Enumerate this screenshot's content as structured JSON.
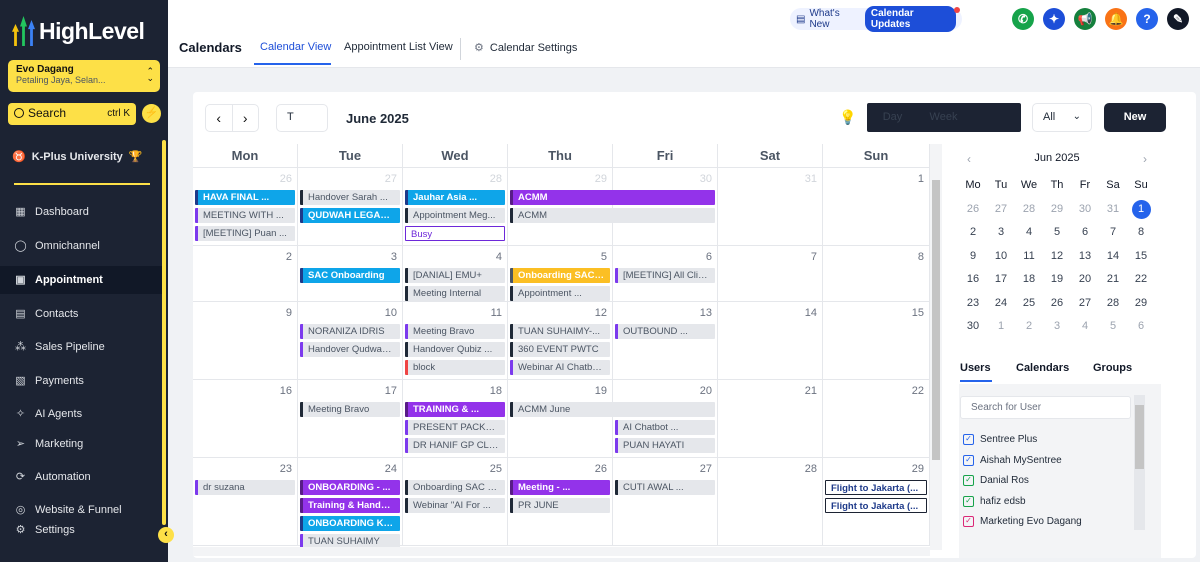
{
  "sidebar": {
    "brand": "HighLevel",
    "account": {
      "name": "Evo Dagang",
      "location": "Petaling Jaya, Selan..."
    },
    "search": {
      "label": "Search",
      "shortcut": "ctrl K"
    },
    "university": "K-Plus University",
    "items": [
      {
        "label": "Dashboard",
        "icon": "dashboard-icon"
      },
      {
        "label": "Omnichannel",
        "icon": "chat-icon"
      },
      {
        "label": "Appointment",
        "icon": "calendar-icon"
      },
      {
        "label": "Contacts",
        "icon": "contacts-icon"
      },
      {
        "label": "Sales Pipeline",
        "icon": "pipeline-icon"
      },
      {
        "label": "Payments",
        "icon": "payments-icon"
      },
      {
        "label": "AI Agents",
        "icon": "sparkle-icon"
      },
      {
        "label": "Marketing",
        "icon": "send-icon"
      },
      {
        "label": "Automation",
        "icon": "automation-icon"
      },
      {
        "label": "Website & Funnel",
        "icon": "globe-icon"
      },
      {
        "label": "Settings",
        "icon": "gear-icon"
      }
    ]
  },
  "header": {
    "title": "Calendars",
    "tabs": [
      {
        "label": "Calendar View"
      },
      {
        "label": "Appointment List View"
      },
      {
        "label": "Calendar Settings"
      }
    ],
    "whats_new": "What's New",
    "updates": "Calendar Updates"
  },
  "toolbar": {
    "today_label": "T",
    "month": "June 2025",
    "views": [
      "Day",
      "Week",
      ""
    ],
    "filter": "All",
    "new_label": "New"
  },
  "colors": {
    "accent": "#2563eb",
    "sidebar": "#1c2333",
    "highlight": "#fde047"
  },
  "calendar": {
    "weekdays": [
      "Mon",
      "Tue",
      "Wed",
      "Thu",
      "Fri",
      "Sat",
      "Sun"
    ],
    "weeks": [
      [
        {
          "d": "26",
          "o": true
        },
        {
          "d": "27",
          "o": true
        },
        {
          "d": "28",
          "o": true
        },
        {
          "d": "29",
          "o": true
        },
        {
          "d": "30",
          "o": true
        },
        {
          "d": "31",
          "o": true
        },
        {
          "d": "1"
        }
      ],
      [
        {
          "d": "2"
        },
        {
          "d": "3"
        },
        {
          "d": "4"
        },
        {
          "d": "5"
        },
        {
          "d": "6"
        },
        {
          "d": "7"
        },
        {
          "d": "8"
        }
      ],
      [
        {
          "d": "9"
        },
        {
          "d": "10"
        },
        {
          "d": "11"
        },
        {
          "d": "12"
        },
        {
          "d": "13"
        },
        {
          "d": "14"
        },
        {
          "d": "15"
        }
      ],
      [
        {
          "d": "16"
        },
        {
          "d": "17"
        },
        {
          "d": "18"
        },
        {
          "d": "19"
        },
        {
          "d": "20"
        },
        {
          "d": "21"
        },
        {
          "d": "22"
        }
      ],
      [
        {
          "d": "23"
        },
        {
          "d": "24"
        },
        {
          "d": "25"
        },
        {
          "d": "26"
        },
        {
          "d": "27"
        },
        {
          "d": "28"
        },
        {
          "d": "29"
        }
      ]
    ],
    "events": [
      {
        "w": 0,
        "d": 0,
        "s": 0,
        "span": 1,
        "t": "HAVA FINAL ...",
        "k": "blue"
      },
      {
        "w": 0,
        "d": 0,
        "s": 1,
        "span": 1,
        "t": "MEETING WITH ...",
        "k": "gray"
      },
      {
        "w": 0,
        "d": 0,
        "s": 2,
        "span": 1,
        "t": "[MEETING] Puan ...",
        "k": "gray"
      },
      {
        "w": 0,
        "d": 1,
        "s": 0,
        "span": 1,
        "t": "Handover Sarah ...",
        "k": "gray dk"
      },
      {
        "w": 0,
        "d": 1,
        "s": 1,
        "span": 1,
        "t": "QUDWAH LEGACY...",
        "k": "blue"
      },
      {
        "w": 0,
        "d": 2,
        "s": 0,
        "span": 1,
        "t": "Jauhar Asia ...",
        "k": "blue"
      },
      {
        "w": 0,
        "d": 2,
        "s": 1,
        "span": 1,
        "t": "Appointment Meg...",
        "k": "gray dk"
      },
      {
        "w": 0,
        "d": 2,
        "s": 2,
        "span": 1,
        "t": "Busy",
        "k": "busy"
      },
      {
        "w": 0,
        "d": 3,
        "s": 0,
        "span": 2,
        "t": "ACMM",
        "k": "purple"
      },
      {
        "w": 0,
        "d": 3,
        "s": 1,
        "span": 2,
        "t": "ACMM",
        "k": "gray dk"
      },
      {
        "w": 1,
        "d": 1,
        "s": 0,
        "span": 1,
        "t": "SAC Onboarding",
        "k": "blue"
      },
      {
        "w": 1,
        "d": 2,
        "s": 0,
        "span": 1,
        "t": "[DANIAL] EMU+",
        "k": "gray dk"
      },
      {
        "w": 1,
        "d": 2,
        "s": 1,
        "span": 1,
        "t": "Meeting Internal",
        "k": "gray dk"
      },
      {
        "w": 1,
        "d": 3,
        "s": 0,
        "span": 1,
        "t": "Onboarding SAC ...",
        "k": "yellow"
      },
      {
        "w": 1,
        "d": 3,
        "s": 1,
        "span": 1,
        "t": "Appointment ...",
        "k": "gray dk"
      },
      {
        "w": 1,
        "d": 4,
        "s": 0,
        "span": 1,
        "t": "[MEETING] All Clie...",
        "k": "gray"
      },
      {
        "w": 2,
        "d": 1,
        "s": 0,
        "span": 1,
        "t": "NORANIZA IDRIS",
        "k": "gray"
      },
      {
        "w": 2,
        "d": 1,
        "s": 1,
        "span": 1,
        "t": "Handover Qudwah...",
        "k": "gray"
      },
      {
        "w": 2,
        "d": 2,
        "s": 0,
        "span": 1,
        "t": "Meeting Bravo",
        "k": "gray"
      },
      {
        "w": 2,
        "d": 2,
        "s": 1,
        "span": 1,
        "t": "Handover Qubiz ...",
        "k": "gray dk"
      },
      {
        "w": 2,
        "d": 2,
        "s": 2,
        "span": 1,
        "t": "block",
        "k": "gray rd"
      },
      {
        "w": 2,
        "d": 3,
        "s": 0,
        "span": 1,
        "t": "TUAN SUHAIMY-...",
        "k": "gray dk"
      },
      {
        "w": 2,
        "d": 3,
        "s": 1,
        "span": 1,
        "t": "360 EVENT PWTC",
        "k": "gray dk"
      },
      {
        "w": 2,
        "d": 3,
        "s": 2,
        "span": 1,
        "t": "Webinar AI Chatbo...",
        "k": "gray"
      },
      {
        "w": 2,
        "d": 4,
        "s": 0,
        "span": 1,
        "t": "OUTBOUND ...",
        "k": "gray"
      },
      {
        "w": 3,
        "d": 1,
        "s": 0,
        "span": 1,
        "t": "Meeting Bravo",
        "k": "gray dk"
      },
      {
        "w": 3,
        "d": 2,
        "s": 0,
        "span": 1,
        "t": "TRAINING & ...",
        "k": "purple"
      },
      {
        "w": 3,
        "d": 2,
        "s": 1,
        "span": 1,
        "t": "PRESENT PACKAG...",
        "k": "gray"
      },
      {
        "w": 3,
        "d": 2,
        "s": 2,
        "span": 1,
        "t": "DR HANIF GP CLINIC",
        "k": "gray"
      },
      {
        "w": 3,
        "d": 3,
        "s": 0,
        "span": 2,
        "t": "ACMM June",
        "k": "gray dk"
      },
      {
        "w": 3,
        "d": 4,
        "s": 1,
        "span": 1,
        "t": "AI Chatbot ...",
        "k": "gray"
      },
      {
        "w": 3,
        "d": 4,
        "s": 2,
        "span": 1,
        "t": "PUAN HAYATI",
        "k": "gray"
      },
      {
        "w": 4,
        "d": 0,
        "s": 0,
        "span": 1,
        "t": "dr suzana",
        "k": "gray"
      },
      {
        "w": 4,
        "d": 1,
        "s": 0,
        "span": 1,
        "t": "ONBOARDING - ...",
        "k": "purple"
      },
      {
        "w": 4,
        "d": 1,
        "s": 1,
        "span": 1,
        "t": "Training & Handov...",
        "k": "purple"
      },
      {
        "w": 4,
        "d": 1,
        "s": 2,
        "span": 1,
        "t": "ONBOARDING KZ ...",
        "k": "blue"
      },
      {
        "w": 4,
        "d": 1,
        "s": 3,
        "span": 1,
        "t": "TUAN SUHAIMY",
        "k": "gray"
      },
      {
        "w": 4,
        "d": 2,
        "s": 0,
        "span": 1,
        "t": "Onboarding SAC - ...",
        "k": "gray dk"
      },
      {
        "w": 4,
        "d": 2,
        "s": 1,
        "span": 1,
        "t": "Webinar \"AI For ...",
        "k": "gray dk"
      },
      {
        "w": 4,
        "d": 3,
        "s": 0,
        "span": 1,
        "t": "Meeting - ...",
        "k": "purple"
      },
      {
        "w": 4,
        "d": 3,
        "s": 1,
        "span": 1,
        "t": "PR JUNE",
        "k": "gray dk"
      },
      {
        "w": 4,
        "d": 4,
        "s": 0,
        "span": 1,
        "t": "CUTI AWAL ...",
        "k": "gray dk"
      },
      {
        "w": 4,
        "d": 6,
        "s": 0,
        "span": 1,
        "t": "Flight to Jakarta (...",
        "k": "outline"
      },
      {
        "w": 4,
        "d": 6,
        "s": 1,
        "span": 1,
        "t": "Flight to Jakarta (...",
        "k": "outline"
      }
    ]
  },
  "mini": {
    "title": "Jun 2025",
    "weekdays": [
      "Mo",
      "Tu",
      "We",
      "Th",
      "Fr",
      "Sa",
      "Su"
    ],
    "days": [
      {
        "d": "26",
        "o": true
      },
      {
        "d": "27",
        "o": true
      },
      {
        "d": "28",
        "o": true
      },
      {
        "d": "29",
        "o": true
      },
      {
        "d": "30",
        "o": true
      },
      {
        "d": "31",
        "o": true
      },
      {
        "d": "1",
        "t": true
      },
      {
        "d": "2"
      },
      {
        "d": "3"
      },
      {
        "d": "4"
      },
      {
        "d": "5"
      },
      {
        "d": "6"
      },
      {
        "d": "7"
      },
      {
        "d": "8"
      },
      {
        "d": "9"
      },
      {
        "d": "10"
      },
      {
        "d": "11"
      },
      {
        "d": "12"
      },
      {
        "d": "13"
      },
      {
        "d": "14"
      },
      {
        "d": "15"
      },
      {
        "d": "16"
      },
      {
        "d": "17"
      },
      {
        "d": "18"
      },
      {
        "d": "19"
      },
      {
        "d": "20"
      },
      {
        "d": "21"
      },
      {
        "d": "22"
      },
      {
        "d": "23"
      },
      {
        "d": "24"
      },
      {
        "d": "25"
      },
      {
        "d": "26"
      },
      {
        "d": "27"
      },
      {
        "d": "28"
      },
      {
        "d": "29"
      },
      {
        "d": "30"
      },
      {
        "d": "1",
        "o": true
      },
      {
        "d": "2",
        "o": true
      },
      {
        "d": "3",
        "o": true
      },
      {
        "d": "4",
        "o": true
      },
      {
        "d": "5",
        "o": true
      },
      {
        "d": "6",
        "o": true
      }
    ]
  },
  "panel": {
    "tabs": [
      "Users",
      "Calendars",
      "Groups"
    ],
    "search_placeholder": "Search for User",
    "users": [
      {
        "name": "Sentree Plus",
        "color": "#2563eb"
      },
      {
        "name": "Aishah MySentree",
        "color": "#2563eb"
      },
      {
        "name": "Danial Ros",
        "color": "#16a34a"
      },
      {
        "name": "hafiz edsb",
        "color": "#16a34a"
      },
      {
        "name": "Marketing Evo Dagang",
        "color": "#db2777"
      }
    ]
  }
}
